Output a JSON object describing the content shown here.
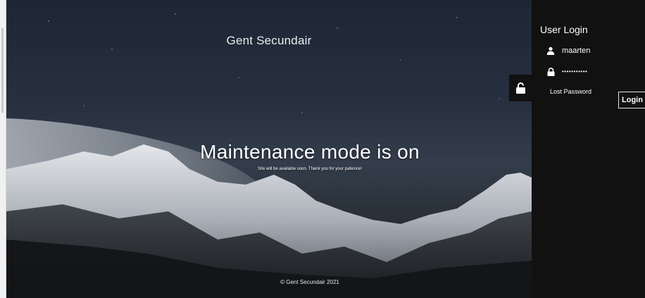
{
  "hero": {
    "site_title": "Gent Secundair",
    "heading": "Maintenance mode is on",
    "subheading": "Site will be available soon. Thank you for your patience!",
    "footer": "© Gent Secundair 2021"
  },
  "login": {
    "title": "User Login",
    "username_value": "maarten",
    "password_value": "•••••••••••",
    "lost_password": "Lost Password",
    "button_label": "Login",
    "user_icon": "user-icon",
    "password_icon": "lock-icon",
    "toggle_icon": "unlock-icon"
  },
  "colors": {
    "panel_bg": "#111111",
    "text": "#ffffff"
  }
}
